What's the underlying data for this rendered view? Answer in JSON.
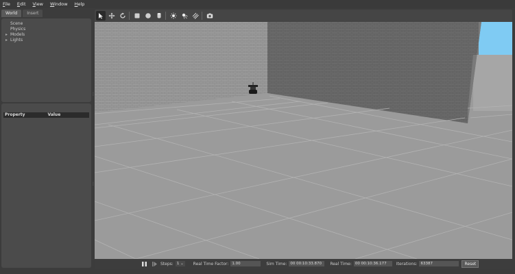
{
  "menu": [
    "File",
    "Edit",
    "View",
    "Window",
    "Help"
  ],
  "left_panel": {
    "tabs": [
      "World",
      "Insert"
    ],
    "tree": [
      {
        "label": "Scene",
        "expandable": false
      },
      {
        "label": "Physics",
        "expandable": false
      },
      {
        "label": "Models",
        "expandable": true
      },
      {
        "label": "Lights",
        "expandable": true
      }
    ],
    "property_headers": {
      "property": "Property",
      "value": "Value"
    }
  },
  "toolbar": {
    "icons": [
      "select-arrow-icon",
      "translate-icon",
      "rotate-icon",
      "box-icon",
      "sphere-icon",
      "cylinder-icon",
      "point-light-icon",
      "spot-light-icon",
      "directional-light-icon",
      "screenshot-icon"
    ]
  },
  "status": {
    "steps_label": "Steps:",
    "steps_value": "1",
    "rtf_label": "Real Time Factor:",
    "rtf_value": "1.00",
    "sim_time_label": "Sim Time:",
    "sim_time_value": "00 00:10:33.870",
    "real_time_label": "Real Time:",
    "real_time_value": "00 00:10:36.177",
    "iterations_label": "Iterations:",
    "iterations_value": "63387",
    "reset_label": "Reset"
  },
  "colors": {
    "sky": "#7fcbf3",
    "ground": "#9b9b9b",
    "wall_light": "#9a9a9a",
    "wall_dark": "#6a6a6a"
  }
}
